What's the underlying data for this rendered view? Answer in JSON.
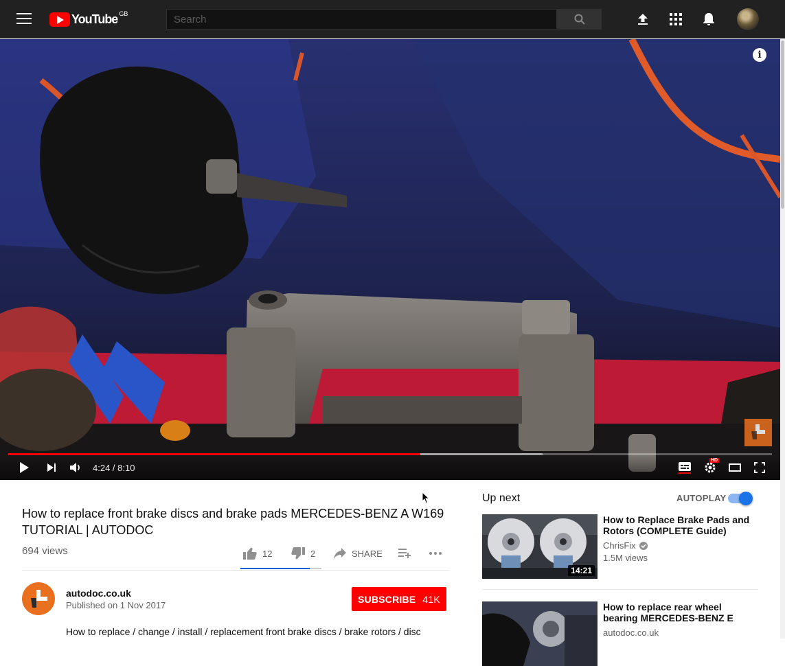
{
  "masthead": {
    "logo_text": "YouTube",
    "region": "GB",
    "search_placeholder": "Search",
    "icons": [
      "menu-icon",
      "search-icon",
      "upload-icon",
      "apps-icon",
      "notifications-icon",
      "avatar"
    ]
  },
  "player": {
    "current_time": "4:24",
    "duration": "8:10",
    "time_separator": " / ",
    "progress_played": 0.54,
    "progress_buffered": 0.7,
    "hd_badge": "HD",
    "info_glyph": "i"
  },
  "video": {
    "title": "How to replace front brake discs and brake pads MERCEDES-BENZ A W169 TUTORIAL | AUTODOC",
    "views": "694 views",
    "likes": "12",
    "dislikes": "2",
    "like_ratio": 0.857,
    "share_label": "SHARE"
  },
  "channel": {
    "name": "autodoc.co.uk",
    "published": "Published on 1 Nov 2017",
    "subscribe_label": "SUBSCRIBE",
    "subscriber_count": "41K",
    "brand_color": "#e8701f"
  },
  "description": "How to replace / change / install / replacement front brake discs / brake rotors / disc",
  "sidebar": {
    "up_next_label": "Up next",
    "autoplay_label": "AUTOPLAY",
    "autoplay_on": true,
    "recommendations": [
      {
        "title": "How to Replace Brake Pads and Rotors (COMPLETE Guide)",
        "channel": "ChrisFix",
        "verified": true,
        "views": "1.5M views",
        "duration": "14:21"
      },
      {
        "title": "How to replace rear wheel bearing MERCEDES-BENZ E",
        "channel": "autodoc.co.uk",
        "verified": false,
        "views": "",
        "duration": ""
      }
    ]
  },
  "colors": {
    "brand_red": "#ff0000",
    "masthead_bg": "#212121",
    "accent_blue": "#065fd4"
  }
}
